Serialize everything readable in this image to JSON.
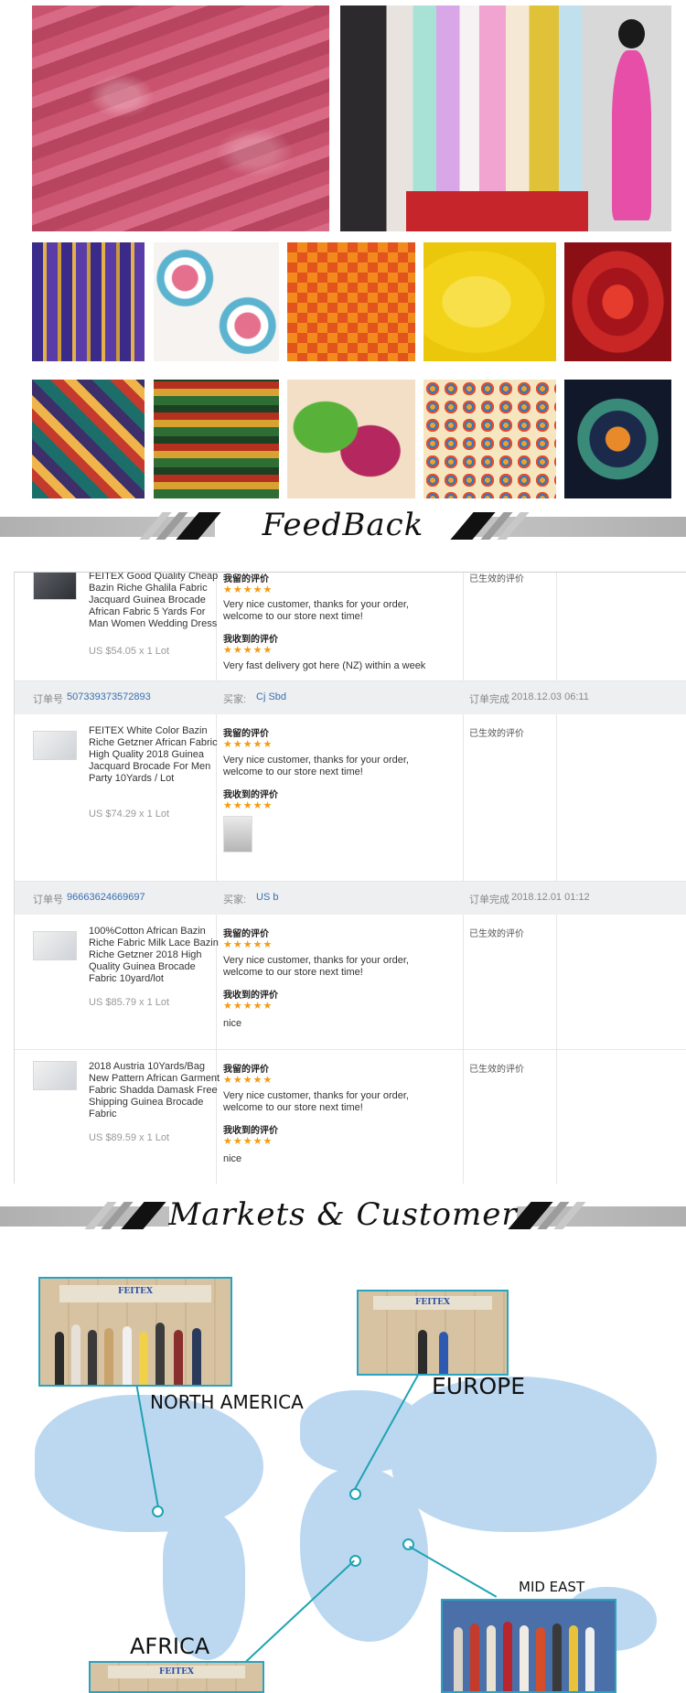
{
  "banners": {
    "feedback": "FeedBack",
    "markets": "Markets & Customer"
  },
  "feedback": {
    "orders": [
      {
        "order_label": "",
        "order_number": "",
        "buyer_label": "",
        "buyer_name": "",
        "completed_label": "",
        "completed_time": "",
        "items": [
          {
            "name": "FEITEX Good Quality Cheap Bazin Riche Ghalila Fabric Jacquard Guinea Brocade African Fabric 5 Yards For Man Women Wedding Dress",
            "price": "US $54.05 x 1 Lot",
            "left_label": "我留的评价",
            "left_text": "Very nice customer, thanks for your order, welcome to our store next time!",
            "received_label": "我收到的评价",
            "received_text": "Very fast delivery got here (NZ) within a week",
            "status": "已生效的评价",
            "stars": "★★★★★"
          }
        ]
      },
      {
        "order_label": "订单号",
        "order_number": "507339373572893",
        "buyer_label": "买家:",
        "buyer_name": "Cj Sbd",
        "completed_label": "订单完成",
        "completed_time": "2018.12.03 06:11",
        "items": [
          {
            "name": "FEITEX White Color Bazin Riche Getzner African Fabric High Quality 2018 Guinea Jacquard Brocade For Men Party 10Yards / Lot",
            "price": "US $74.29 x 1 Lot",
            "left_label": "我留的评价",
            "left_text": "Very nice customer, thanks for your order, welcome to our store next time!",
            "received_label": "我收到的评价",
            "received_text": "",
            "status": "已生效的评价",
            "stars": "★★★★★"
          }
        ]
      },
      {
        "order_label": "订单号",
        "order_number": "96663624669697",
        "buyer_label": "买家:",
        "buyer_name": "US b",
        "completed_label": "订单完成",
        "completed_time": "2018.12.01 01:12",
        "items": [
          {
            "name": "100%Cotton African Bazin Riche Fabric Milk Lace Bazin Riche Getzner 2018 High Quality Guinea Brocade Fabric 10yard/lot",
            "price": "US $85.79 x 1 Lot",
            "left_label": "我留的评价",
            "left_text": "Very nice customer, thanks for your order, welcome to our store next time!",
            "received_label": "我收到的评价",
            "received_text": "nice",
            "status": "已生效的评价",
            "stars": "★★★★★"
          },
          {
            "name": "2018 Austria 10Yards/Bag New Pattern African Garment Fabric Shadda Damask Free Shipping Guinea Brocade Fabric",
            "price": "US $89.59 x 1 Lot",
            "left_label": "我留的评价",
            "left_text": "Very nice customer, thanks for your order, welcome to our store next time!",
            "received_label": "我收到的评价",
            "received_text": "nice",
            "status": "已生效的评价",
            "stars": "★★★★★"
          }
        ]
      }
    ]
  },
  "markets": {
    "regions": {
      "north_america": "NORTH AMERICA",
      "europe": "EUROPE",
      "mid_east": "MID EAST",
      "africa": "AFRICA"
    },
    "sign_text": "FEITEX",
    "accent_color": "#1fa3b3",
    "map_color": "#bcd8f1"
  }
}
